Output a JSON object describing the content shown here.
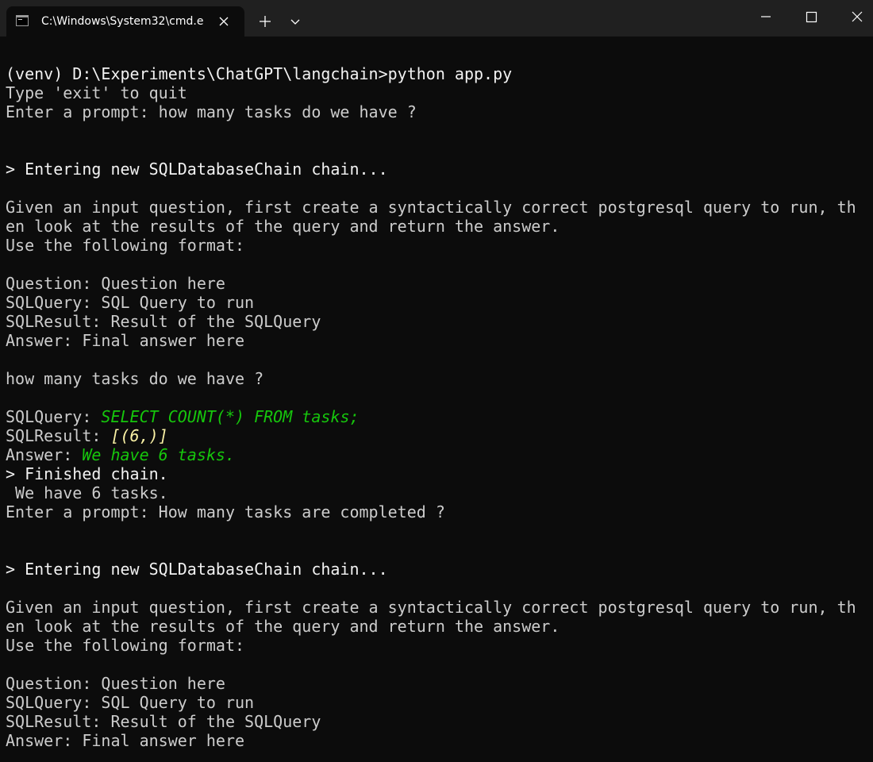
{
  "window": {
    "tab_title": "C:\\Windows\\System32\\cmd.e",
    "tab_icon": "cmd-icon",
    "tab_close_icon": "close-icon",
    "new_tab_icon": "plus-icon",
    "dropdown_icon": "chevron-down-icon",
    "minimize_icon": "minimize-icon",
    "maximize_icon": "maximize-icon",
    "close_icon": "close-icon"
  },
  "colors": {
    "background": "#0c0c0c",
    "titlebar": "#202020",
    "text": "#cccccc",
    "bright_text": "#f2f2f2",
    "sql_green": "#16c60c",
    "result_yellow": "#f9f1a5"
  },
  "terminal": {
    "l1": "(venv) D:\\Experiments\\ChatGPT\\langchain>python app.py",
    "l2": "Type 'exit' to quit",
    "l3": "Enter a prompt: how many tasks do we have ?",
    "l4": "> Entering new SQLDatabaseChain chain...",
    "l5": "Given an input question, first create a syntactically correct postgresql query to run, th",
    "l6": "en look at the results of the query and return the answer.",
    "l7": "Use the following format:",
    "l8": "Question: Question here",
    "l9": "SQLQuery: SQL Query to run",
    "l10": "SQLResult: Result of the SQLQuery",
    "l11": "Answer: Final answer here",
    "l12": "how many tasks do we have ?",
    "l13_prefix": "SQLQuery: ",
    "l13_value": "SELECT COUNT(*) FROM tasks;",
    "l14_prefix": "SQLResult: ",
    "l14_value": "[(6,)]",
    "l15_prefix": "Answer: ",
    "l15_value": "We have 6 tasks.",
    "l16": "> Finished chain.",
    "l17": " We have 6 tasks.",
    "l18": "Enter a prompt: How many tasks are completed ?",
    "l19": "> Entering new SQLDatabaseChain chain...",
    "l20": "Given an input question, first create a syntactically correct postgresql query to run, th",
    "l21": "en look at the results of the query and return the answer.",
    "l22": "Use the following format:",
    "l23": "Question: Question here",
    "l24": "SQLQuery: SQL Query to run",
    "l25": "SQLResult: Result of the SQLQuery",
    "l26": "Answer: Final answer here"
  }
}
